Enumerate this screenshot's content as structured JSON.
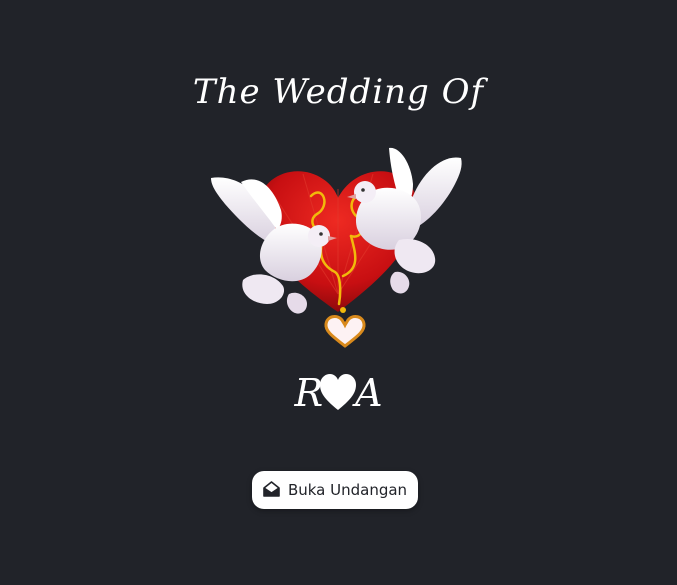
{
  "title": "The Wedding Of",
  "couple": {
    "left_initial": "R",
    "right_initial": "A",
    "separator_icon": "heart-icon"
  },
  "hero_image": {
    "icon": "doves-heart-illustration"
  },
  "open_button": {
    "label": "Buka Undangan",
    "icon": "envelope-open-icon"
  },
  "colors": {
    "background": "#212329",
    "heart_red": "#c80f12",
    "button_bg": "#ffffff",
    "button_text": "#212329"
  }
}
